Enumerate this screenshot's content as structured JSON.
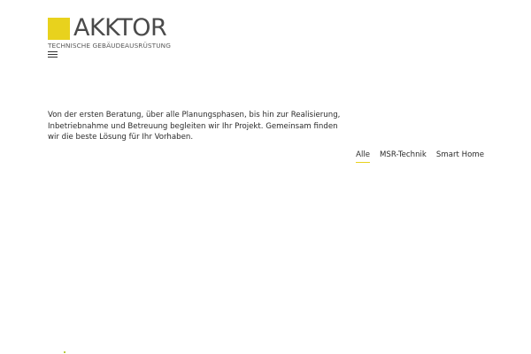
{
  "brand": {
    "name": "AKKTOR",
    "tagline": "TECHNISCHE GEBÄUDEAUSRÜSTUNG",
    "accent_color": "#e8d21d"
  },
  "nav": {
    "menu_icon": "hamburger-menu-icon"
  },
  "intro": {
    "text": "Von der ersten Beratung, über alle Planungsphasen, bis hin zur Realisierung, Inbetriebnahme und Betreuung begleiten wir Ihr Projekt. Gemeinsam finden wir die beste Lösung für Ihr Vorhaben."
  },
  "filters": {
    "items": [
      {
        "label": "Alle",
        "active": true
      },
      {
        "label": "MSR-Technik",
        "active": false
      },
      {
        "label": "Smart Home",
        "active": false
      }
    ]
  }
}
